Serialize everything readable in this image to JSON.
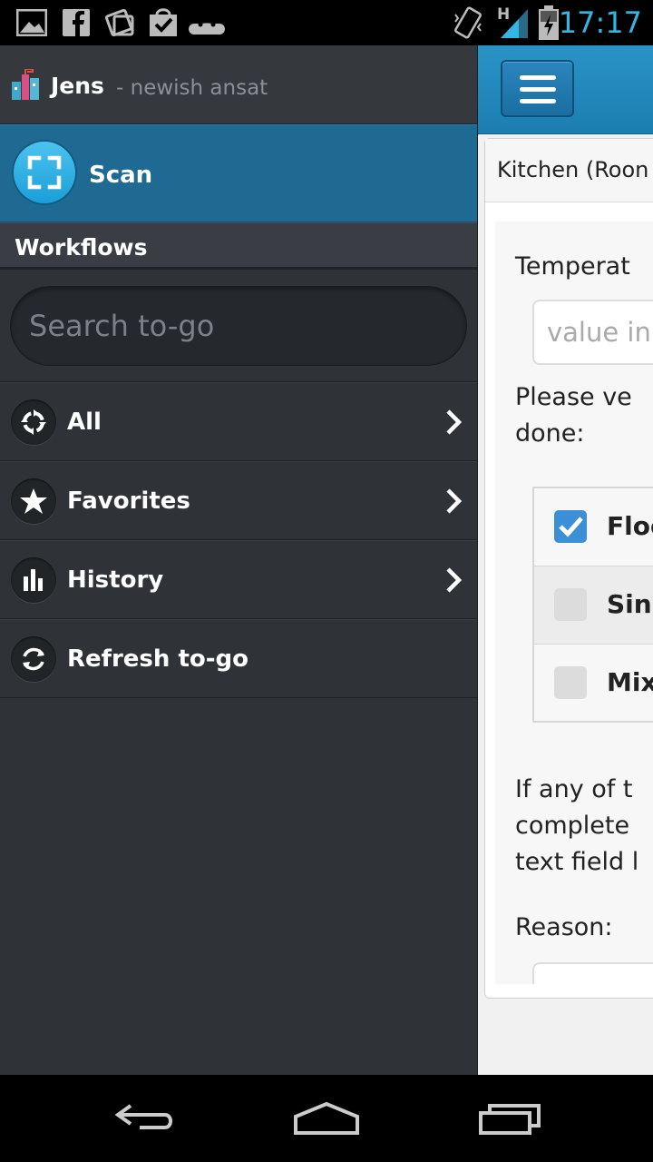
{
  "status_bar": {
    "time": "17:17",
    "network_type": "H",
    "left_icons": [
      "gallery-icon",
      "facebook-icon",
      "photos-icon",
      "shopping-bag-icon",
      "android-icon"
    ],
    "right_icons": [
      "vibrate-icon",
      "signal-icon",
      "battery-charging-icon"
    ],
    "accent": "#33b5e5"
  },
  "drawer": {
    "user": {
      "name": "Jens",
      "subtitle": "- newish ansat"
    },
    "scan": {
      "label": "Scan"
    },
    "section_title": "Workflows",
    "search": {
      "placeholder": "Search to-go",
      "value": ""
    },
    "items": [
      {
        "label": "All",
        "icon": "recycle-arrows-icon",
        "has_chevron": true
      },
      {
        "label": "Favorites",
        "icon": "star-icon",
        "has_chevron": true
      },
      {
        "label": "History",
        "icon": "bar-chart-icon",
        "has_chevron": true
      },
      {
        "label": "Refresh to-go",
        "icon": "refresh-icon",
        "has_chevron": false
      }
    ]
  },
  "main": {
    "card_title": "Kitchen (Roon",
    "temperature_label": "Temperat",
    "temperature_placeholder": "value in",
    "verify_line1": "Please ve",
    "verify_line2": "done:",
    "checks": [
      {
        "label": "Floo",
        "checked": true
      },
      {
        "label": "Sinl",
        "checked": false
      },
      {
        "label": "Mix",
        "checked": false
      }
    ],
    "note_line1": "If any of t",
    "note_line2": "complete",
    "note_line3": "text field l",
    "reason_label": "Reason:"
  },
  "colors": {
    "drawer_bg": "#2f3338",
    "scan_row": "#1e6a93",
    "topbar": "#1f85b8",
    "checkbox_on": "#3a8fd6"
  }
}
